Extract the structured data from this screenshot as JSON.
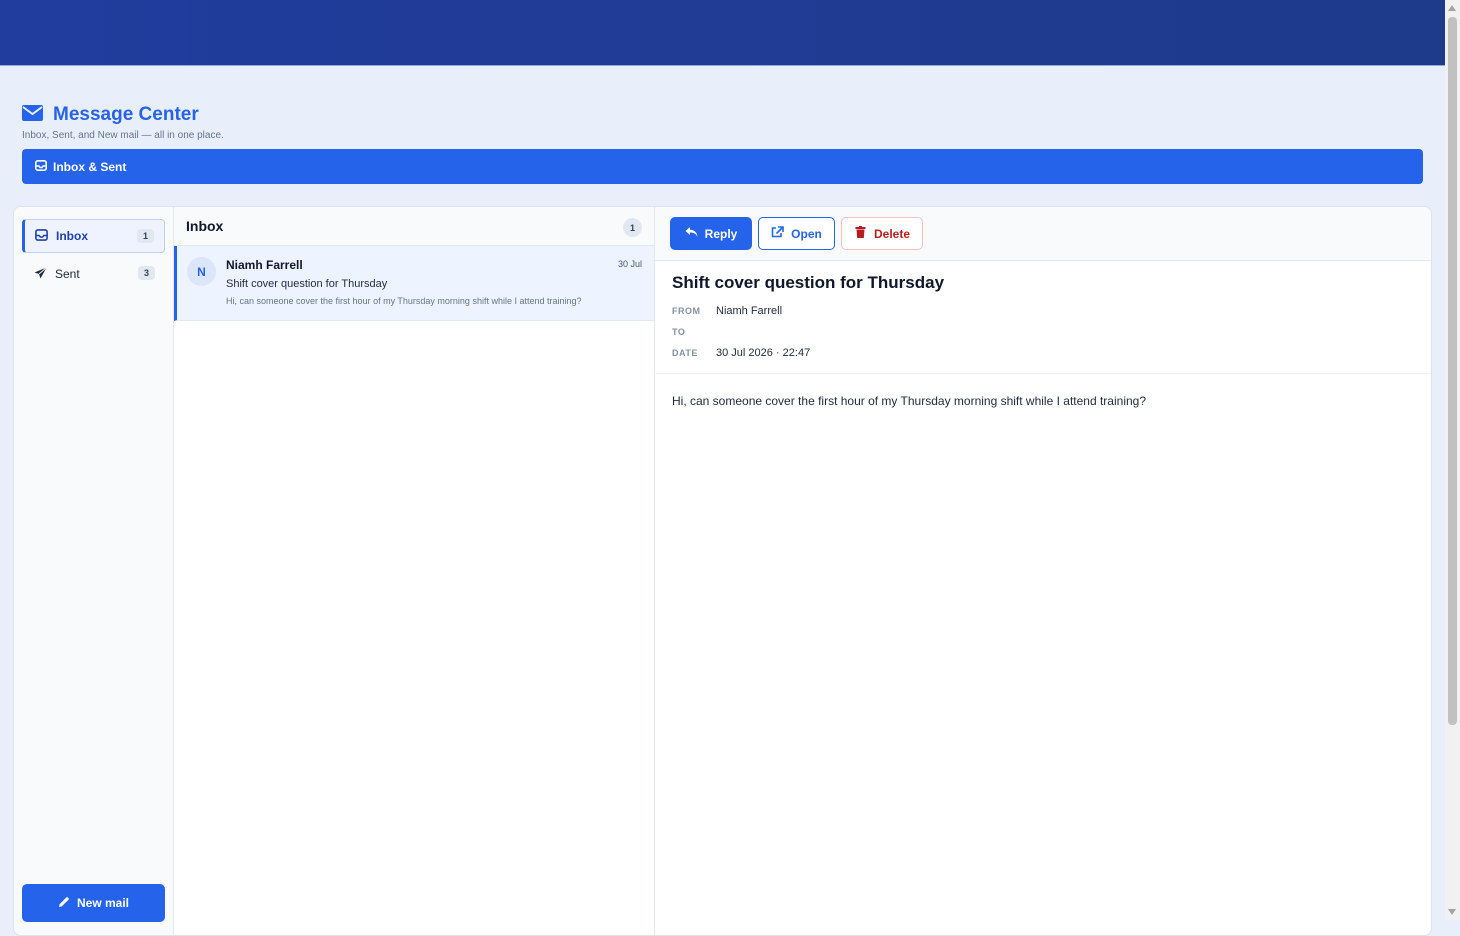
{
  "app": {
    "title": "Message Center",
    "subtitle": "Inbox, Sent, and New mail — all in one place.",
    "title_icon": "envelope-icon"
  },
  "tabs": [
    {
      "label": "Inbox & Sent",
      "icon": "inbox-icon",
      "active": true
    }
  ],
  "sidebar": {
    "folders": [
      {
        "label": "Inbox",
        "count": "1",
        "icon": "inbox-icon",
        "active": true
      },
      {
        "label": "Sent",
        "count": "3",
        "icon": "paper-plane-icon",
        "active": false
      }
    ],
    "new_mail_label": "New mail"
  },
  "list": {
    "title": "Inbox",
    "count": "1",
    "messages": [
      {
        "avatar_initial": "N",
        "sender": "Niamh Farrell",
        "date": "30 Jul",
        "subject": "Shift cover question for Thursday",
        "preview": "Hi, can someone cover the first hour of my Thursday morning shift while I attend training?",
        "selected": true
      }
    ]
  },
  "reader": {
    "actions": {
      "reply": "Reply",
      "open": "Open",
      "delete": "Delete"
    },
    "subject": "Shift cover question for Thursday",
    "labels": {
      "from": "FROM",
      "to": "TO",
      "date": "DATE"
    },
    "from": "Niamh Farrell",
    "to": "",
    "date": "30 Jul 2026 · 22:47",
    "body": "Hi, can someone cover the first hour of my Thursday morning shift while I attend training?"
  },
  "colors": {
    "accent": "#2563eb",
    "header_bar": "#1e3a8a",
    "danger": "#b91c1c",
    "page_bg": "#e9effa"
  }
}
